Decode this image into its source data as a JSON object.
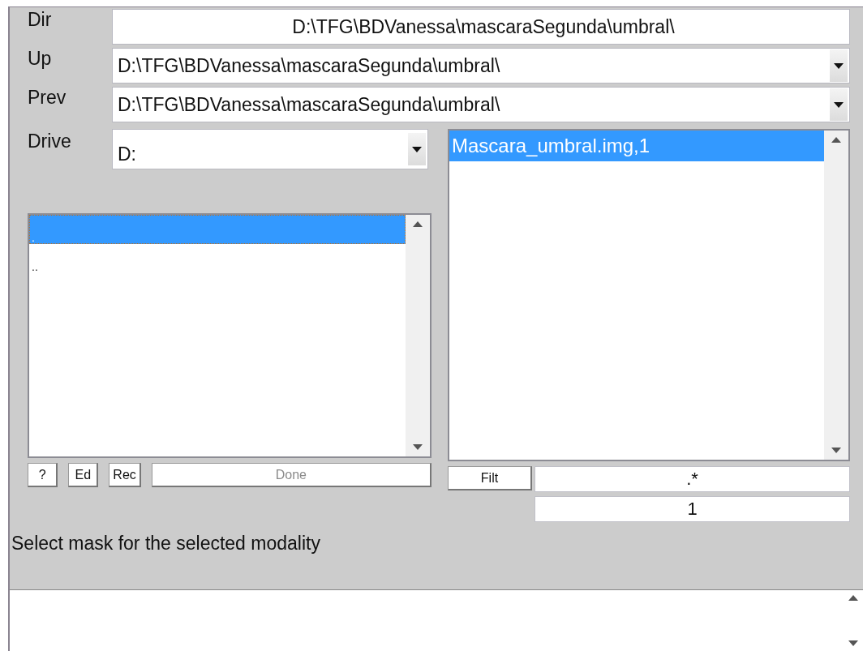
{
  "path_rows": [
    {
      "label": "Dir",
      "value": "D:\\TFG\\BDVanessa\\mascaraSegunda\\umbral\\",
      "kind": "text"
    },
    {
      "label": "Up",
      "value": "D:\\TFG\\BDVanessa\\mascaraSegunda\\umbral\\",
      "kind": "combo"
    },
    {
      "label": "Prev",
      "value": "D:\\TFG\\BDVanessa\\mascaraSegunda\\umbral\\",
      "kind": "combo"
    }
  ],
  "drive": {
    "label": "Drive",
    "value": "D:"
  },
  "folders": [
    {
      "name": ".",
      "selected": true
    },
    {
      "name": "..",
      "selected": false
    }
  ],
  "files": [
    {
      "name": "Mascara_umbral.img,1",
      "selected": true
    }
  ],
  "buttons": [
    {
      "label": "?",
      "disabled": false
    },
    {
      "label": "Ed",
      "disabled": false
    },
    {
      "label": "Rec",
      "disabled": false
    },
    {
      "label": "Done",
      "disabled": true
    }
  ],
  "filter_button": "Filt",
  "filter": ".*",
  "frame": "1",
  "message": "Select mask for the selected modality"
}
